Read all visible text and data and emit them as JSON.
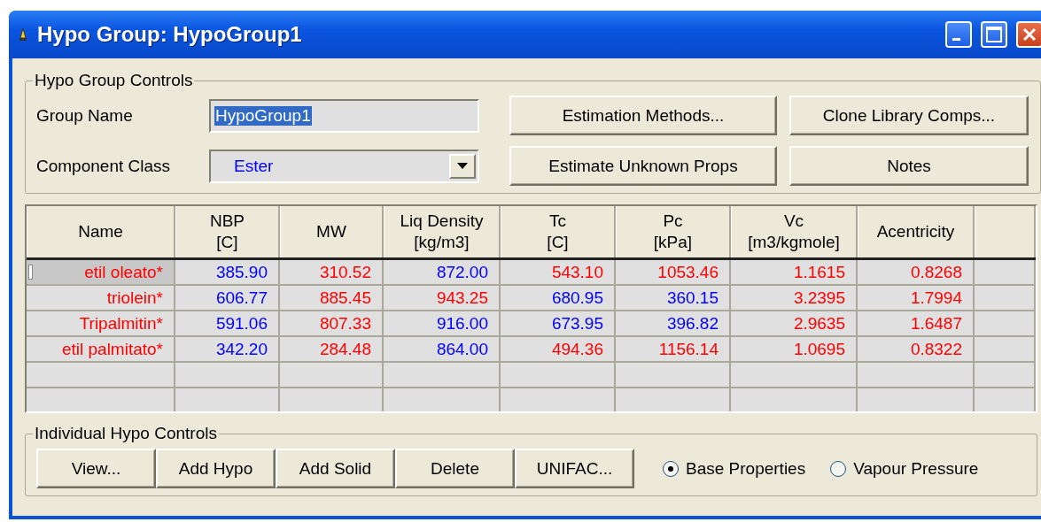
{
  "window": {
    "title": "Hypo Group: HypoGroup1"
  },
  "group_controls": {
    "title": "Hypo Group Controls",
    "group_name": {
      "label": "Group Name",
      "value": "HypoGroup1"
    },
    "component_class": {
      "label": "Component Class",
      "value": "Ester"
    },
    "buttons": [
      "Estimation Methods...",
      "Clone Library Comps...",
      "Estimate Unknown Props",
      "Notes"
    ]
  },
  "table": {
    "columns": [
      "Name",
      "NBP\n[C]",
      "MW",
      "Liq Density\n[kg/m3]",
      "Tc\n[C]",
      "Pc\n[kPa]",
      "Vc\n[m3/kgmole]",
      "Acentricity"
    ],
    "rows": [
      {
        "selected": true,
        "cells": [
          {
            "text": "etil oleato*",
            "color": "#ff0000"
          },
          {
            "text": "385.90",
            "color": "#0000ff"
          },
          {
            "text": "310.52",
            "color": "#ff0000"
          },
          {
            "text": "872.00",
            "color": "#0000ff"
          },
          {
            "text": "543.10",
            "color": "#ff0000"
          },
          {
            "text": "1053.46",
            "color": "#ff0000"
          },
          {
            "text": "1.1615",
            "color": "#ff0000"
          },
          {
            "text": "0.8268",
            "color": "#ff0000"
          }
        ]
      },
      {
        "selected": false,
        "cells": [
          {
            "text": "triolein*",
            "color": "#ff0000"
          },
          {
            "text": "606.77",
            "color": "#0000ff"
          },
          {
            "text": "885.45",
            "color": "#ff0000"
          },
          {
            "text": "943.25",
            "color": "#ff0000"
          },
          {
            "text": "680.95",
            "color": "#0000ff"
          },
          {
            "text": "360.15",
            "color": "#0000ff"
          },
          {
            "text": "3.2395",
            "color": "#ff0000"
          },
          {
            "text": "1.7994",
            "color": "#ff0000"
          }
        ]
      },
      {
        "selected": false,
        "cells": [
          {
            "text": "Tripalmitin*",
            "color": "#ff0000"
          },
          {
            "text": "591.06",
            "color": "#0000ff"
          },
          {
            "text": "807.33",
            "color": "#ff0000"
          },
          {
            "text": "916.00",
            "color": "#0000ff"
          },
          {
            "text": "673.95",
            "color": "#0000ff"
          },
          {
            "text": "396.82",
            "color": "#0000ff"
          },
          {
            "text": "2.9635",
            "color": "#ff0000"
          },
          {
            "text": "1.6487",
            "color": "#ff0000"
          }
        ]
      },
      {
        "selected": false,
        "cells": [
          {
            "text": "etil palmitato*",
            "color": "#ff0000"
          },
          {
            "text": "342.20",
            "color": "#0000ff"
          },
          {
            "text": "284.48",
            "color": "#ff0000"
          },
          {
            "text": "864.00",
            "color": "#0000ff"
          },
          {
            "text": "494.36",
            "color": "#ff0000"
          },
          {
            "text": "1156.14",
            "color": "#ff0000"
          },
          {
            "text": "1.0695",
            "color": "#ff0000"
          },
          {
            "text": "0.8322",
            "color": "#ff0000"
          }
        ]
      }
    ]
  },
  "individual_controls": {
    "title": "Individual Hypo Controls",
    "buttons": [
      "View...",
      "Add Hypo",
      "Add Solid",
      "Delete",
      "UNIFAC..."
    ],
    "options": [
      {
        "label": "Base Properties",
        "selected": true
      },
      {
        "label": "Vapour Pressure",
        "selected": false
      }
    ]
  }
}
